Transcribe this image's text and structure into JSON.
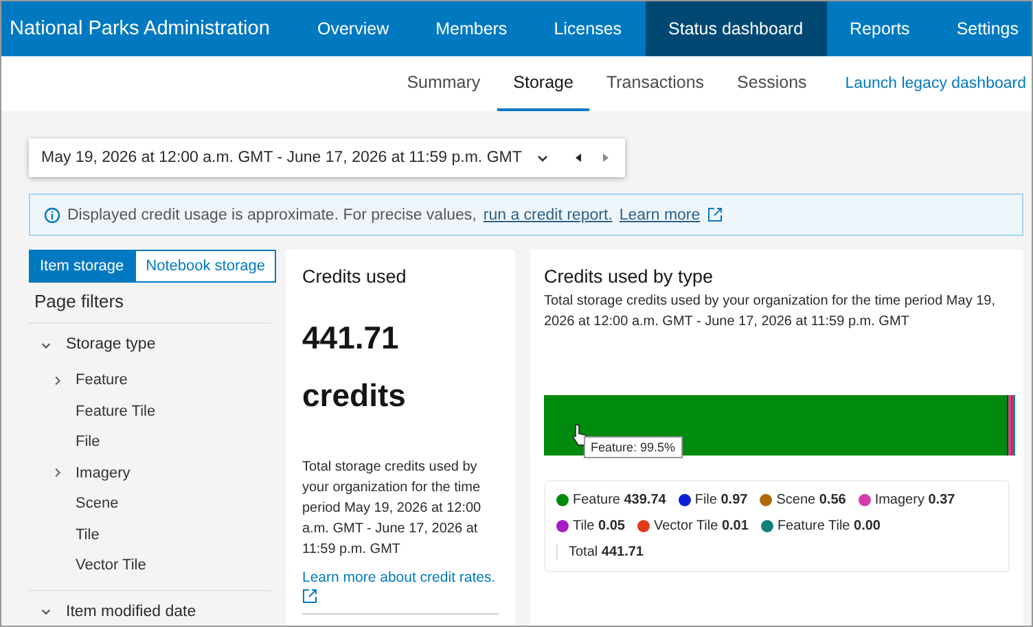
{
  "app_title": "National Parks Administration",
  "nav": [
    {
      "label": "Overview",
      "selected": false
    },
    {
      "label": "Members",
      "selected": false
    },
    {
      "label": "Licenses",
      "selected": false
    },
    {
      "label": "Status dashboard",
      "selected": true
    },
    {
      "label": "Reports",
      "selected": false
    },
    {
      "label": "Settings",
      "selected": false
    }
  ],
  "subnav": [
    {
      "label": "Summary",
      "selected": false
    },
    {
      "label": "Storage",
      "selected": true
    },
    {
      "label": "Transactions",
      "selected": false
    },
    {
      "label": "Sessions",
      "selected": false
    }
  ],
  "legacy_link": "Launch legacy dashboard",
  "date_range": "May 19, 2026 at 12:00 a.m. GMT - June 17, 2026 at 11:59 p.m. GMT",
  "notice": {
    "text": "Displayed credit usage is approximate. For precise values,",
    "link": "run a credit report.",
    "learn_more": "Learn more"
  },
  "storage_tabs": [
    {
      "label": "Item storage",
      "selected": true
    },
    {
      "label": "Notebook storage",
      "selected": false
    }
  ],
  "filters_title": "Page filters",
  "filters": [
    {
      "label": "Storage type",
      "expanded": true,
      "children": [
        {
          "label": "Feature",
          "expandable": true
        },
        {
          "label": "Feature Tile",
          "expandable": false
        },
        {
          "label": "File",
          "expandable": false
        },
        {
          "label": "Imagery",
          "expandable": true
        },
        {
          "label": "Scene",
          "expandable": false
        },
        {
          "label": "Tile",
          "expandable": false
        },
        {
          "label": "Vector Tile",
          "expandable": false
        }
      ]
    },
    {
      "label": "Item modified date",
      "expanded": true
    }
  ],
  "credits_card": {
    "title": "Credits used",
    "value": "441.71",
    "unit": "credits",
    "description": "Total storage credits used by your organization for the time period May 19, 2026 at 12:00 a.m. GMT - June 17, 2026 at 11:59 p.m. GMT",
    "link": "Learn more about credit rates."
  },
  "type_card": {
    "title": "Credits used by type",
    "description": "Total storage credits used by your organization for the time period May 19, 2026 at 12:00 a.m. GMT - June 17, 2026 at 11:59 p.m. GMT",
    "tooltip": "Feature: 99.5%",
    "legend": [
      {
        "name": "Feature",
        "value": "439.74",
        "color": "#008a0e"
      },
      {
        "name": "File",
        "value": "0.97",
        "color": "#0a1fd6"
      },
      {
        "name": "Scene",
        "value": "0.56",
        "color": "#b06a0c"
      },
      {
        "name": "Imagery",
        "value": "0.37",
        "color": "#d63ba8"
      },
      {
        "name": "Tile",
        "value": "0.05",
        "color": "#a51bc9"
      },
      {
        "name": "Vector Tile",
        "value": "0.01",
        "color": "#e03a1c"
      },
      {
        "name": "Feature Tile",
        "value": "0.00",
        "color": "#11807c"
      }
    ],
    "total_label": "Total",
    "total_value": "441.71"
  }
}
